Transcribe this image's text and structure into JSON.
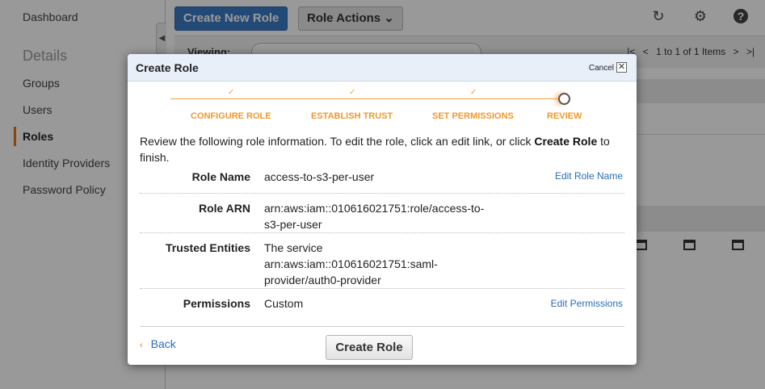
{
  "sidebar": {
    "dashboard": "Dashboard",
    "heading": "Details",
    "items": [
      {
        "label": "Groups"
      },
      {
        "label": "Users"
      },
      {
        "label": "Roles"
      },
      {
        "label": "Identity Providers"
      },
      {
        "label": "Password Policy"
      }
    ],
    "collapse_icon": "chevron-left-icon"
  },
  "toolbar": {
    "create_new_role": "Create New Role",
    "role_actions": "Role Actions ⌄",
    "refresh_icon": "refresh-icon",
    "settings_icon": "gear-icon",
    "help_icon": "help-icon"
  },
  "list": {
    "viewing_label": "Viewing:",
    "pager_text": "1 to 1 of 1 Items",
    "pager_first": "|<",
    "pager_prev": "<",
    "pager_next": ">",
    "pager_last": ">|"
  },
  "modal": {
    "title": "Create Role",
    "cancel": "Cancel",
    "close": "✕",
    "steps": [
      {
        "label": "CONFIGURE ROLE",
        "done": true
      },
      {
        "label": "ESTABLISH TRUST",
        "done": true
      },
      {
        "label": "SET PERMISSIONS",
        "done": true
      },
      {
        "label": "REVIEW",
        "done": false
      }
    ],
    "check_glyph": "✓",
    "intro_before": "Review the following role information. To edit the role, click an edit link, or click ",
    "intro_bold": "Create Role",
    "intro_after": " to finish.",
    "rows": [
      {
        "label": "Role Name",
        "value": "access-to-s3-per-user",
        "link": "Edit Role Name"
      },
      {
        "label": "Role ARN",
        "value_lines": [
          "arn:aws:iam::010616021751:role/access-to-",
          "s3-per-user"
        ]
      },
      {
        "label": "Trusted Entities",
        "value_lines": [
          "The service",
          "arn:aws:iam::010616021751:saml-",
          "provider/auth0-provider"
        ]
      },
      {
        "label": "Permissions",
        "value": "Custom",
        "link": "Edit Permissions"
      }
    ],
    "back_caret": "‹",
    "back": "Back",
    "create_button": "Create Role"
  },
  "colors": {
    "primary_button": "#3b7cc7",
    "wizard_accent": "#f0982a",
    "link": "#2a6db5",
    "header_band": "#e8eff9"
  }
}
